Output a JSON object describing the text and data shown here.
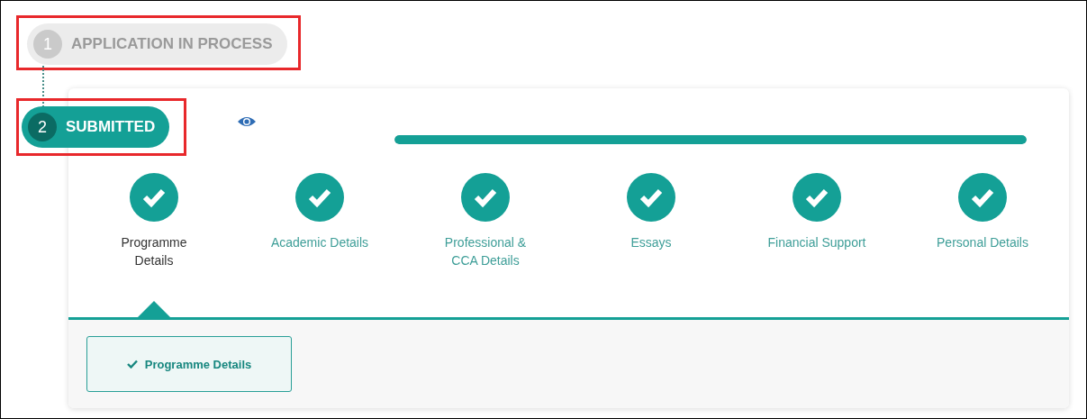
{
  "stages": [
    {
      "number": "1",
      "label": "APPLICATION IN PROCESS",
      "selected": false
    },
    {
      "number": "2",
      "label": "SUBMITTED",
      "selected": true
    }
  ],
  "progress": {
    "level": 1
  },
  "steps": [
    {
      "label": "Programme Details",
      "completed": true,
      "selected": true
    },
    {
      "label": "Academic Details",
      "completed": true,
      "selected": false
    },
    {
      "label": "Professional & CCA Details",
      "completed": true,
      "selected": false
    },
    {
      "label": "Essays",
      "completed": true,
      "selected": false
    },
    {
      "label": "Financial Support",
      "completed": true,
      "selected": false
    },
    {
      "label": "Personal Details",
      "completed": true,
      "selected": false
    }
  ],
  "sections": [
    {
      "label": "Programme Details",
      "checked": true
    }
  ]
}
